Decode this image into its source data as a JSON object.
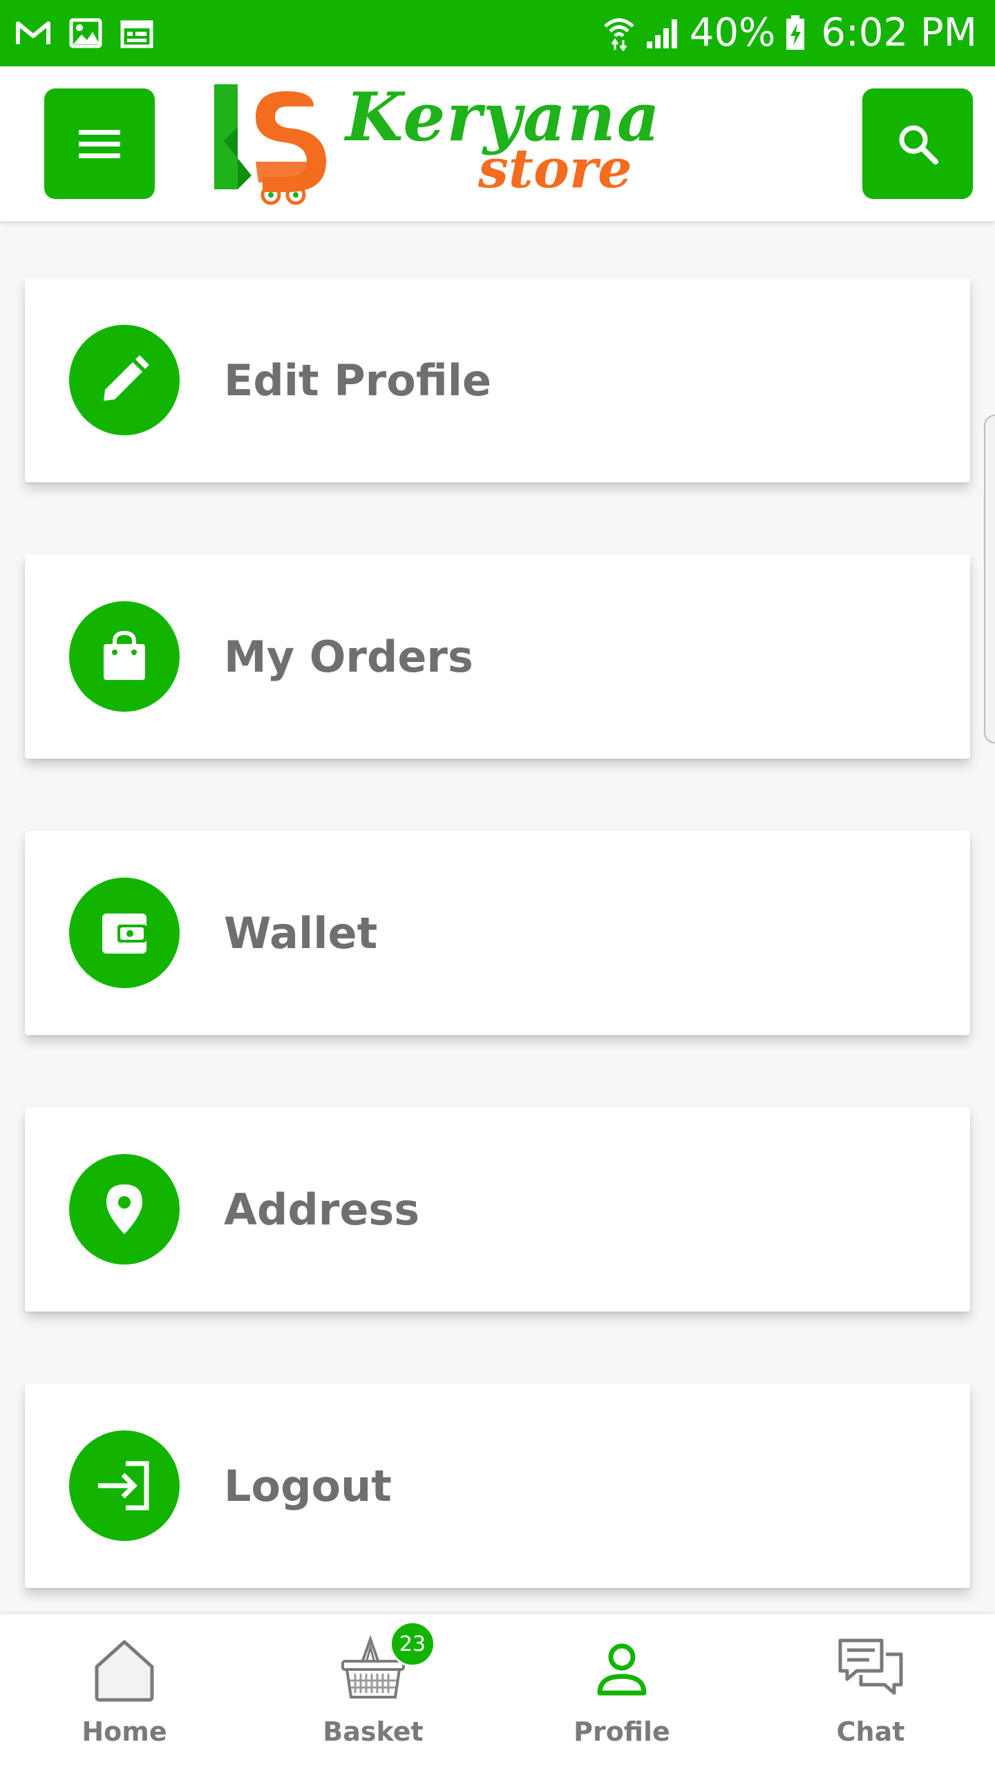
{
  "status_bar": {
    "icons_left": [
      "gmail-icon",
      "gallery-icon",
      "calendar-icon"
    ],
    "icons_right": [
      "wifi-icon",
      "signal-icon",
      "battery-charging-icon"
    ],
    "battery": "40%",
    "time": "6:02 PM"
  },
  "app_bar": {
    "logo_word_1": "Keryana",
    "logo_word_2": "store",
    "menu_icon": "hamburger-menu-icon",
    "search_icon": "search-icon"
  },
  "menu": {
    "items": [
      {
        "label": "Edit Profile",
        "icon": "pencil-icon"
      },
      {
        "label": "My Orders",
        "icon": "shopping-bag-icon"
      },
      {
        "label": "Wallet",
        "icon": "wallet-icon"
      },
      {
        "label": "Address",
        "icon": "location-pin-icon"
      },
      {
        "label": "Logout",
        "icon": "logout-icon"
      }
    ]
  },
  "bottom_nav": {
    "items": [
      {
        "label": "Home",
        "icon": "home-icon",
        "active": false
      },
      {
        "label": "Basket",
        "icon": "basket-icon",
        "active": false,
        "badge": "23"
      },
      {
        "label": "Profile",
        "icon": "profile-icon",
        "active": true
      },
      {
        "label": "Chat",
        "icon": "chat-icon",
        "active": false
      }
    ]
  },
  "colors": {
    "brand_green": "#12b400",
    "logo_orange": "#f36c1f",
    "label_gray": "#6f6f6f"
  }
}
